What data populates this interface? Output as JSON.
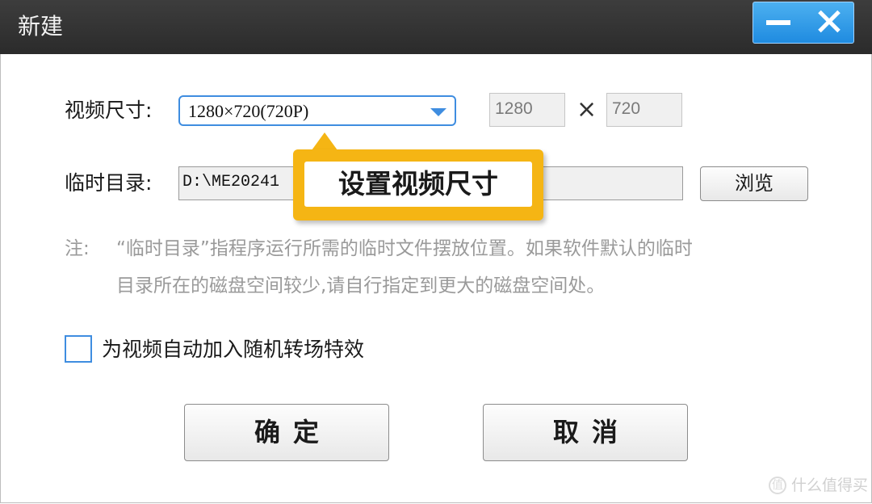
{
  "window": {
    "title": "新建"
  },
  "video_size": {
    "label": "视频尺寸:",
    "selected": "1280×720(720P)",
    "width": "1280",
    "times": "×",
    "height": "720"
  },
  "temp_dir": {
    "label": "临时目录:",
    "path": "D:\\ME20241",
    "browse_label": "浏览"
  },
  "note": {
    "prefix": "注:",
    "line1": "“临时目录”指程序运行所需的临时文件摆放位置。如果软件默认的临时",
    "line2": "目录所在的磁盘空间较少,请自行指定到更大的磁盘空间处。"
  },
  "random_transition": {
    "label": "为视频自动加入随机转场特效",
    "checked": false
  },
  "actions": {
    "ok_label": "确定",
    "cancel_label": "取消"
  },
  "tooltip": {
    "text": "设置视频尺寸"
  },
  "watermark": {
    "icon": "值",
    "text": "什么值得买"
  },
  "colors": {
    "accent": "#3f8de0",
    "tooltip": "#f5b514",
    "titlebar": "#333333"
  }
}
